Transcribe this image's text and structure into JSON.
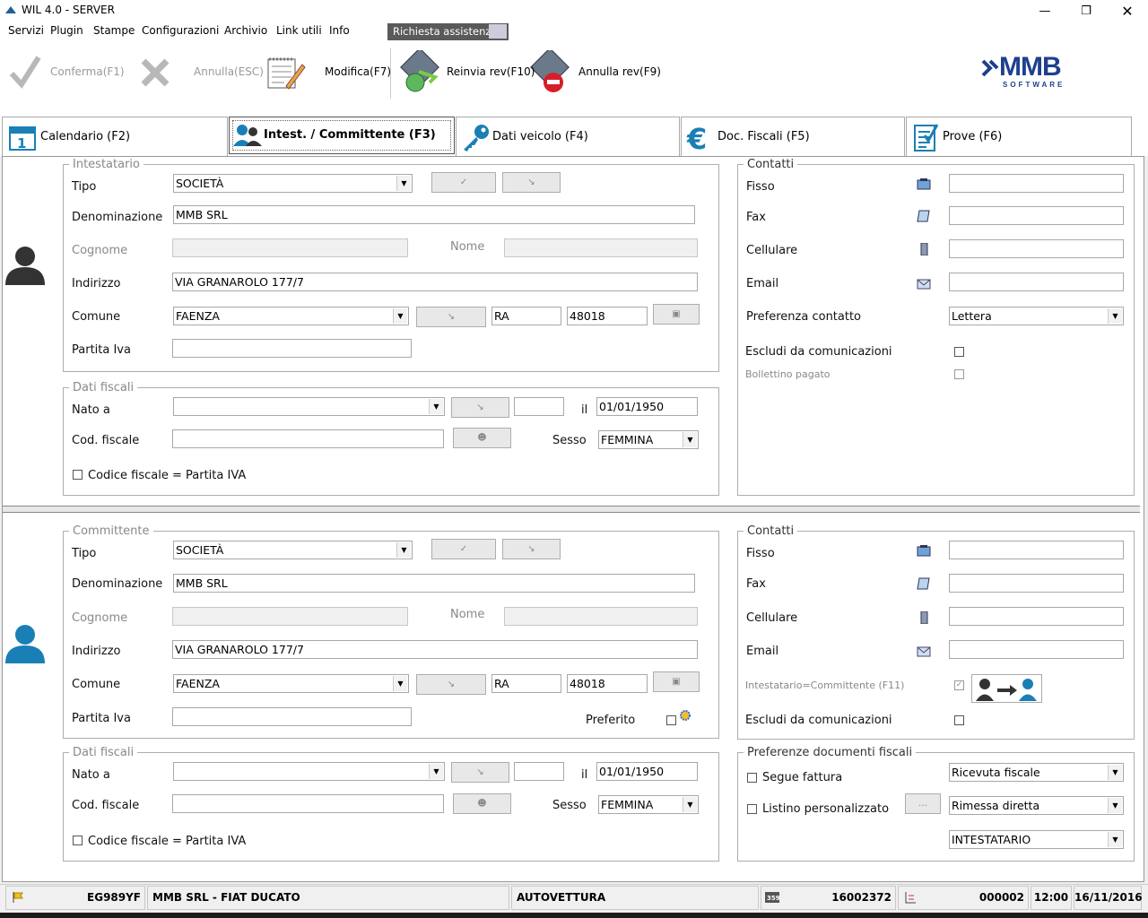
{
  "window": {
    "title": "WIL 4.0 - SERVER"
  },
  "menu": [
    "Servizi",
    "Plugin",
    "Stampe",
    "Configurazioni",
    "Archivio",
    "Link utili",
    "Info"
  ],
  "assist_label": "Richiesta assistenza",
  "toolbar": {
    "confirm": "Conferma(F1)",
    "cancel": "Annulla(ESC)",
    "modify": "Modifica(F7)",
    "resend": "Reinvia rev(F10)",
    "cancel_rev": "Annulla rev(F9)"
  },
  "logo": {
    "name": "MMB",
    "sub": "SOFTWARE"
  },
  "tabs": [
    "Calendario (F2)",
    "Intest. / Committente (F3)",
    "Dati veicolo (F4)",
    "Doc. Fiscali (F5)",
    "Prove (F6)"
  ],
  "intestatario": {
    "legend": "Intestatario",
    "labels": {
      "tipo": "Tipo",
      "denominazione": "Denominazione",
      "cognome": "Cognome",
      "nome": "Nome",
      "indirizzo": "Indirizzo",
      "comune": "Comune",
      "piva": "Partita Iva"
    },
    "tipo": "SOCIETÀ",
    "denominazione": "MMB SRL",
    "indirizzo": "VIA GRANAROLO 177/7",
    "comune": "FAENZA",
    "provincia": "RA",
    "cap": "48018",
    "piva": ""
  },
  "fiscali1": {
    "legend": "Dati fiscali",
    "nato_label": "Nato a",
    "il_label": "il",
    "data": "01/01/1950",
    "cf_label": "Cod. fiscale",
    "sesso_label": "Sesso",
    "sesso": "FEMMINA",
    "cf_eq_label": "Codice fiscale = Partita IVA"
  },
  "contatti1": {
    "legend": "Contatti",
    "fisso": "Fisso",
    "fax": "Fax",
    "cellulare": "Cellulare",
    "email": "Email",
    "preferenza": "Preferenza contatto",
    "preferenza_val": "Lettera",
    "escludi": "Escludi da comunicazioni",
    "bollettino": "Bollettino pagato"
  },
  "committente": {
    "legend": "Committente",
    "labels": {
      "tipo": "Tipo",
      "denominazione": "Denominazione",
      "cognome": "Cognome",
      "nome": "Nome",
      "indirizzo": "Indirizzo",
      "comune": "Comune",
      "piva": "Partita Iva",
      "preferito": "Preferito"
    },
    "tipo": "SOCIETÀ",
    "denominazione": "MMB SRL",
    "indirizzo": "VIA GRANAROLO 177/7",
    "comune": "FAENZA",
    "provincia": "RA",
    "cap": "48018"
  },
  "fiscali2": {
    "legend": "Dati fiscali",
    "nato_label": "Nato a",
    "il_label": "il",
    "data": "01/01/1950",
    "cf_label": "Cod. fiscale",
    "sesso_label": "Sesso",
    "sesso": "FEMMINA",
    "cf_eq_label": "Codice fiscale = Partita IVA"
  },
  "contatti2": {
    "legend": "Contatti",
    "fisso": "Fisso",
    "fax": "Fax",
    "cellulare": "Cellulare",
    "email": "Email",
    "int_eq_comm": "Intestatario=Committente (F11)",
    "escludi": "Escludi da comunicazioni"
  },
  "prefdoc": {
    "legend": "Preferenze documenti fiscali",
    "segue": "Segue fattura",
    "listino": "Listino personalizzato",
    "ricevuta": "Ricevuta fiscale",
    "rimessa": "Rimessa diretta",
    "intestatario": "INTESTATARIO"
  },
  "status": {
    "targa": "EG989YF",
    "descr": "MMB SRL - FIAT DUCATO",
    "tipo": "AUTOVETTURA",
    "code": "16002372",
    "num": "000002",
    "time": "12:00",
    "date": "16/11/2016"
  },
  "colors": {
    "accent": "#1a7fb5",
    "user_icon_dark": "#333333"
  }
}
